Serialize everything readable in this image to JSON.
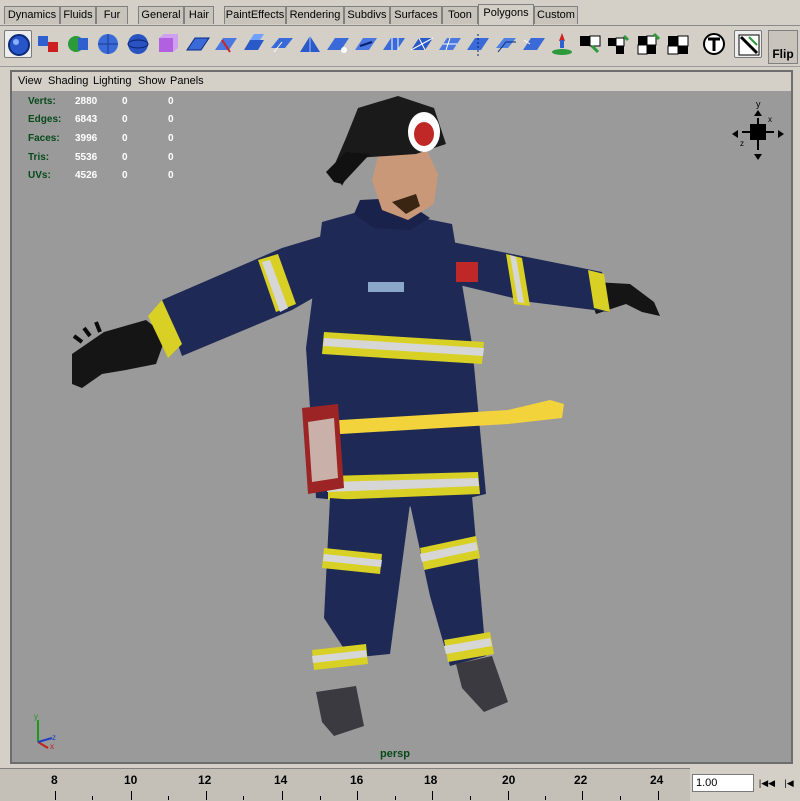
{
  "shelf_tabs": [
    "Dynamics",
    "Fluids",
    "Fur",
    "General",
    "Hair",
    "PaintEffects",
    "Rendering",
    "Subdivs",
    "Surfaces",
    "Toon",
    "Polygons",
    "Custom"
  ],
  "active_tab": "Polygons",
  "shelf": {
    "flip_label": "Flip"
  },
  "panel_menu": [
    "View",
    "Shading",
    "Lighting",
    "Show",
    "Panels"
  ],
  "hud": {
    "rows": [
      {
        "label": "Verts:",
        "total": "2880",
        "selected": "0",
        "selected2": "0"
      },
      {
        "label": "Edges:",
        "total": "6843",
        "selected": "0",
        "selected2": "0"
      },
      {
        "label": "Faces:",
        "total": "3996",
        "selected": "0",
        "selected2": "0"
      },
      {
        "label": "Tris:",
        "total": "5536",
        "selected": "0",
        "selected2": "0"
      },
      {
        "label": "UVs:",
        "total": "4526",
        "selected": "0",
        "selected2": "0"
      }
    ]
  },
  "camera_name": "persp",
  "time_slider": {
    "labels": [
      "8",
      "10",
      "12",
      "14",
      "16",
      "18",
      "20",
      "22",
      "24"
    ],
    "current_time": "1.00"
  },
  "colors": {
    "hud_green": "#064a1a",
    "viewport_bg": "#9a9a9a",
    "uniform_blue": "#1e2a55",
    "reflective_yellow": "#e8e030",
    "axe_handle": "#f2d33c"
  }
}
